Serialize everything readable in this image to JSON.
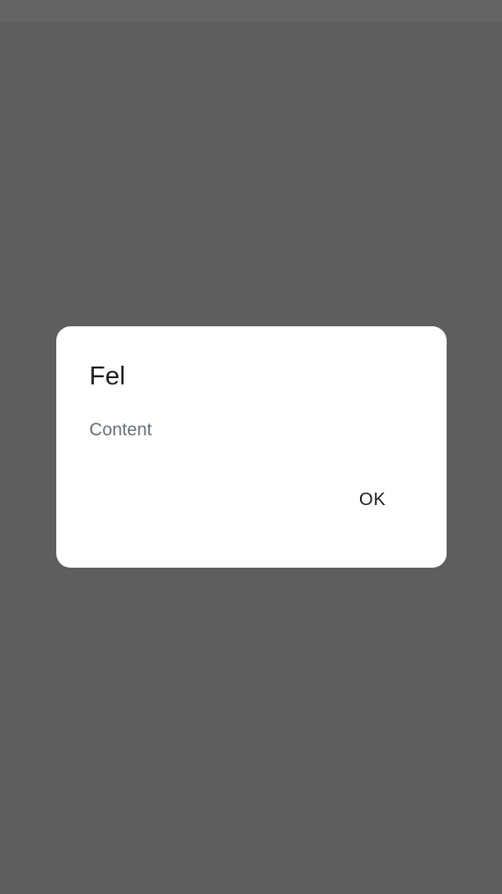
{
  "dialog": {
    "title": "Fel",
    "content": "Content",
    "ok_label": "OK"
  },
  "colors": {
    "scrim": "#5e5e5e",
    "dialog_background": "#ffffff",
    "title_text": "#1c1b1f",
    "content_text": "#6a6f74"
  }
}
